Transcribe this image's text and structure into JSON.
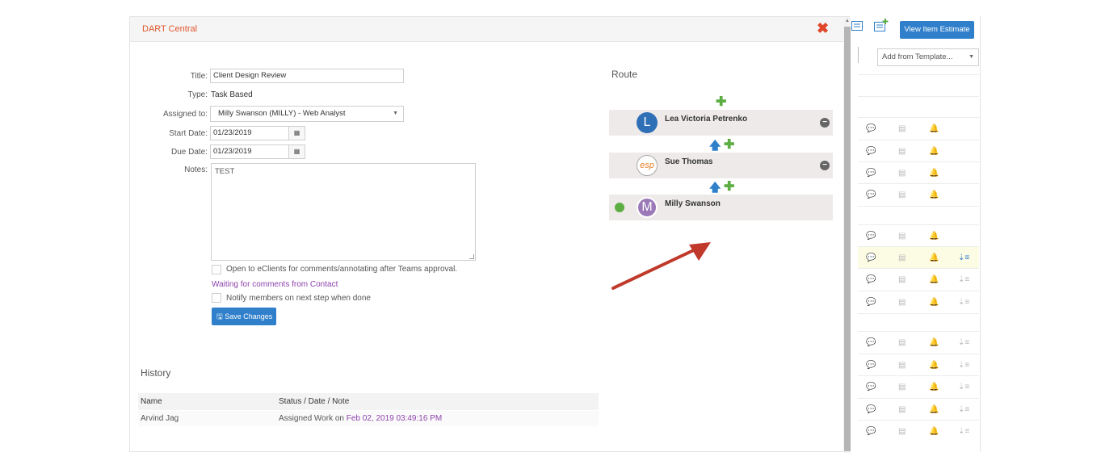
{
  "modal": {
    "title": "DART Central",
    "close_glyph": "✖"
  },
  "form": {
    "title_label": "Title:",
    "title_value": "Client Design Review",
    "type_label": "Type:",
    "type_value": "Task Based",
    "assigned_label": "Assigned to:",
    "assigned_value": "Milly Swanson (MILLY) - Web Analyst",
    "start_label": "Start Date:",
    "start_value": "01/23/2019",
    "due_label": "Due Date:",
    "due_value": "01/23/2019",
    "notes_label": "Notes:",
    "notes_value": "TEST",
    "eclients_checkbox_label": "Open to eClients for comments/annotating after Teams approval.",
    "waiting_text": "Waiting for comments from Contact",
    "notify_checkbox_label": "Notify members on next step when done",
    "save_label": "Save Changes"
  },
  "history": {
    "title": "History",
    "col_name": "Name",
    "col_status": "Status / Date / Note",
    "rows": [
      {
        "name": "Arvind Jag",
        "status": "Assigned Work on",
        "date": "Feb 02, 2019 03:49:16 PM"
      }
    ]
  },
  "route": {
    "title": "Route",
    "items": [
      {
        "name": "Lea Victoria Petrenko",
        "avatar": "L"
      },
      {
        "name": "Sue Thomas",
        "avatar": "esp"
      },
      {
        "name": "Milly Swanson",
        "avatar": "M"
      }
    ]
  },
  "background": {
    "estimate_button": "View Item Estimate",
    "template_select": "Add from Template..."
  },
  "colors": {
    "accent_blue": "#2f7fcb",
    "title_orange": "#e0562b",
    "close_red": "#e0472a",
    "add_green": "#5cae44",
    "link_purple": "#8e44ad",
    "arrow_red": "#c0392b"
  }
}
